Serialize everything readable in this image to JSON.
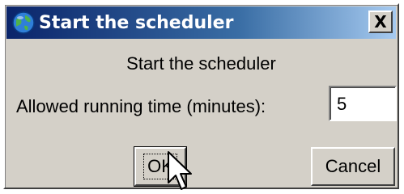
{
  "window": {
    "title": "Start the scheduler",
    "close_label": "X"
  },
  "dialog": {
    "heading": "Start the scheduler",
    "field_label": "Allowed running time (minutes):",
    "field_value": "5"
  },
  "buttons": {
    "ok_label": "OK",
    "cancel_label": "Cancel"
  },
  "icons": {
    "title_icon": "globe-icon",
    "cursor": "mouse-pointer-icon"
  },
  "colors": {
    "titlebar_start": "#0a246a",
    "titlebar_end": "#a6caf0",
    "face": "#d4d0c8"
  }
}
